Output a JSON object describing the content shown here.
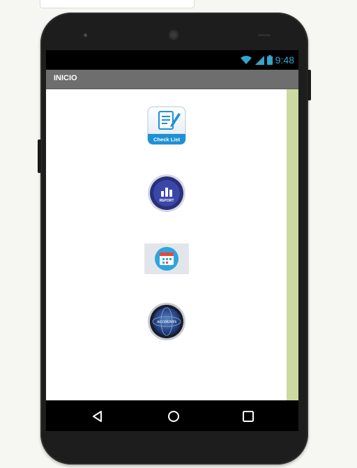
{
  "status_bar": {
    "time": "9:48",
    "icons": [
      "wifi-icon",
      "signal-icon",
      "battery-icon"
    ]
  },
  "app": {
    "title": "INICIO"
  },
  "buttons": [
    {
      "name": "checklist-button",
      "label": "Check List",
      "icon": "checklist-icon"
    },
    {
      "name": "reports-button",
      "label": "REPORT",
      "icon": "bar-chart-icon"
    },
    {
      "name": "calendar-button",
      "label": "",
      "icon": "calendar-icon"
    },
    {
      "name": "accounts-button",
      "label": "ACCOUNTS",
      "icon": "globe-icon"
    }
  ],
  "nav": {
    "buttons": [
      "back-icon",
      "home-icon",
      "recents-icon"
    ]
  },
  "colors": {
    "title_bar": "#6e6e6e",
    "status_time": "#34a5cc",
    "right_strip": "#ccd9a0"
  }
}
